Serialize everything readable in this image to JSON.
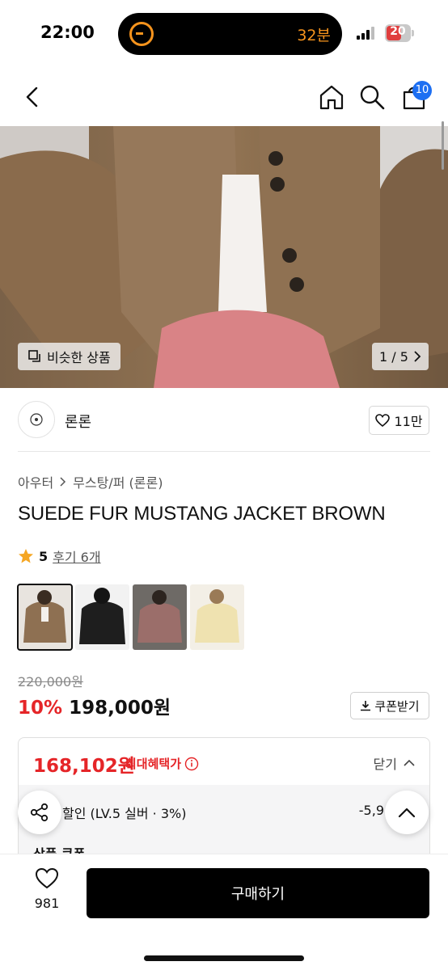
{
  "status_bar": {
    "time": "22:00",
    "timer": "32분",
    "battery": "20"
  },
  "nav": {
    "cart_count": "10"
  },
  "hero": {
    "similar_label": "비슷한 상품",
    "page": "1 / 5"
  },
  "brand": {
    "name": "론론",
    "likes": "11만"
  },
  "breadcrumb": {
    "level1": "아우터",
    "level2": "무스탕/퍼 (론론)"
  },
  "product": {
    "title": "SUEDE FUR MUSTANG JACKET BROWN",
    "rating": "5",
    "reviews": "후기 6개",
    "thumbnails": [
      {
        "name": "brown",
        "color": "#8e7052"
      },
      {
        "name": "black",
        "color": "#1e1e1e"
      },
      {
        "name": "pink",
        "color": "#9b6e6a"
      },
      {
        "name": "cream",
        "color": "#efe2b0"
      }
    ]
  },
  "price": {
    "original": "220,000원",
    "discount": "10%",
    "sale": "198,000원",
    "coupon_label": "쿠폰받기"
  },
  "benefit": {
    "max_price": "168,102원",
    "max_label": "최대혜택가",
    "toggle_label": "닫기",
    "discount_line": "할인 (LV.5 실버 · 3%)",
    "discount_amount": "-5,9",
    "coupon_line": "상품 쿠폰"
  },
  "bottom": {
    "wish_count": "981",
    "buy_label": "구매하기"
  },
  "colors": {
    "accent_red": "#e52528",
    "badge_blue": "#1d6ff2",
    "timer_orange": "#f7941d"
  }
}
